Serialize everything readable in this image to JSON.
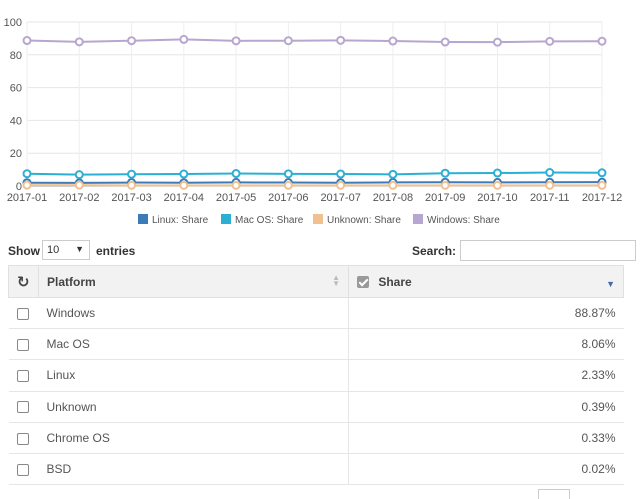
{
  "chart_data": {
    "type": "line",
    "x": [
      "2017-01",
      "2017-02",
      "2017-03",
      "2017-04",
      "2017-05",
      "2017-06",
      "2017-07",
      "2017-08",
      "2017-09",
      "2017-10",
      "2017-11",
      "2017-12"
    ],
    "ylim": [
      0,
      100
    ],
    "yticks": [
      0,
      20,
      40,
      60,
      80,
      100
    ],
    "grid": true,
    "legend_position": "bottom",
    "series": [
      {
        "name": "Linux: Share",
        "color": "#3c7ab8",
        "values": [
          2.0,
          1.9,
          2.1,
          2.0,
          2.2,
          2.1,
          2.0,
          2.2,
          2.3,
          2.2,
          2.3,
          2.33
        ]
      },
      {
        "name": "Mac OS: Share",
        "color": "#2bb0d4",
        "values": [
          7.5,
          6.9,
          7.2,
          7.3,
          7.6,
          7.4,
          7.3,
          7.1,
          7.8,
          7.9,
          8.2,
          8.06
        ]
      },
      {
        "name": "Unknown: Share",
        "color": "#f0c090",
        "values": [
          0.5,
          0.5,
          0.4,
          0.4,
          0.4,
          0.4,
          0.4,
          0.4,
          0.4,
          0.4,
          0.4,
          0.39
        ]
      },
      {
        "name": "Windows: Share",
        "color": "#b7a6cf",
        "values": [
          88.7,
          87.9,
          88.6,
          89.4,
          88.5,
          88.6,
          88.8,
          88.4,
          87.8,
          87.7,
          88.2,
          88.3
        ]
      }
    ]
  },
  "controls": {
    "show_label": "Show",
    "length_value": "10",
    "entries_label": "entries",
    "search_label": "Search:",
    "search_value": ""
  },
  "table": {
    "headers": {
      "platform": "Platform",
      "share": "Share"
    },
    "rows": [
      {
        "platform": "Windows",
        "share": "88.87%"
      },
      {
        "platform": "Mac OS",
        "share": "8.06%"
      },
      {
        "platform": "Linux",
        "share": "2.33%"
      },
      {
        "platform": "Unknown",
        "share": "0.39%"
      },
      {
        "platform": "Chrome OS",
        "share": "0.33%"
      },
      {
        "platform": "BSD",
        "share": "0.02%"
      }
    ]
  }
}
